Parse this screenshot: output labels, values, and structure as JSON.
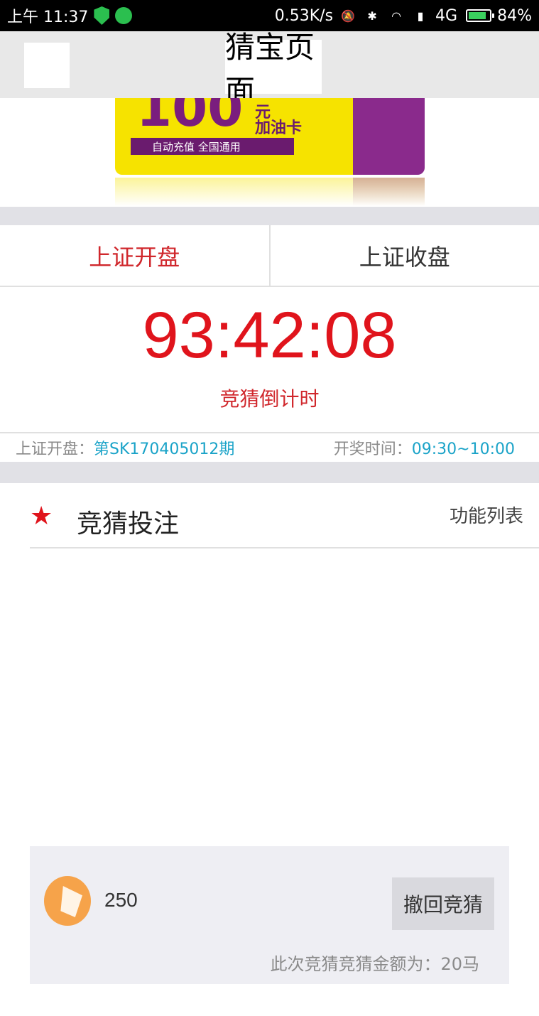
{
  "status_bar": {
    "time": "上午 11:37",
    "net_speed": "0.53K/s",
    "network": "4G",
    "battery": "84%",
    "battery_level": 0.84
  },
  "header": {
    "title": "猜宝页面"
  },
  "banner": {
    "amount": "100",
    "yuan": "元",
    "title": "加油卡",
    "subtitle": "自动充值  全国通用"
  },
  "tabs": [
    {
      "label": "上证开盘",
      "active": true
    },
    {
      "label": "上证收盘",
      "active": false
    }
  ],
  "countdown": {
    "time": "93:42:08",
    "label": "竞猜倒计时"
  },
  "info": {
    "period_label": "上证开盘：",
    "period_value": "第SK170405012期",
    "draw_label": "开奖时间：",
    "draw_value": "09:30~10:00"
  },
  "section": {
    "title": "竞猜投注",
    "function_list": "功能列表"
  },
  "bet": {
    "coins": "250",
    "withdraw_label": "撤回竞猜",
    "note": "此次竞猜竞猜金额为：20马"
  },
  "colors": {
    "accent_red": "#e0141c",
    "info_blue": "#1aa3c8"
  }
}
